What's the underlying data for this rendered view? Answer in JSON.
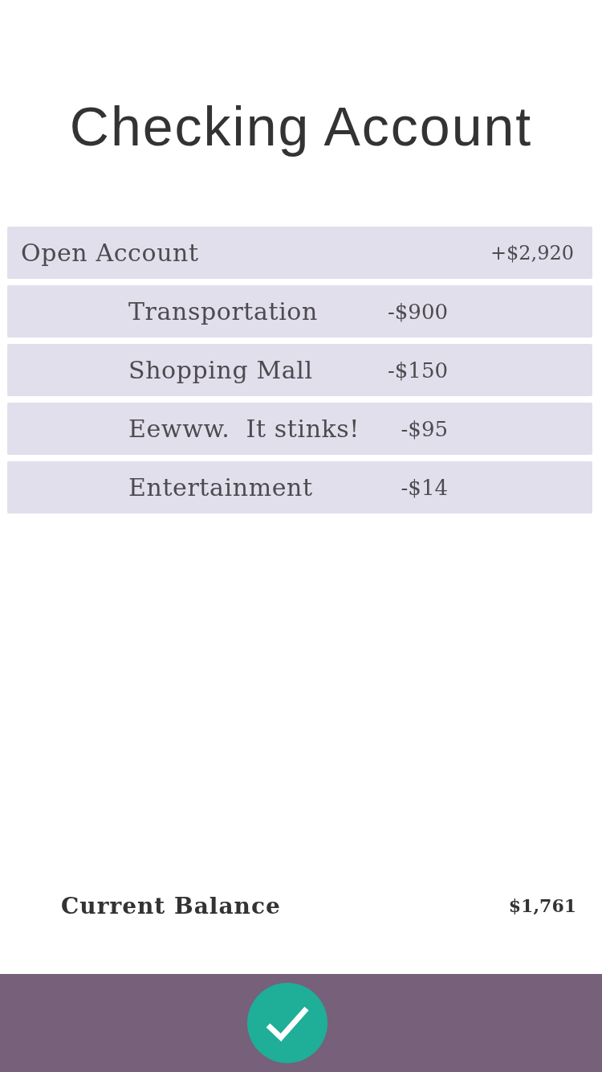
{
  "header": {
    "title": "Checking Account"
  },
  "transactions": [
    {
      "kind": "opening",
      "label": "Open Account",
      "amount": "+$2,920"
    },
    {
      "kind": "expense",
      "label": "Transportation",
      "amount": "-$900"
    },
    {
      "kind": "expense",
      "label": "Shopping Mall",
      "amount": "-$150"
    },
    {
      "kind": "expense",
      "label": "Eewww.  It stinks!",
      "amount": "-$95"
    },
    {
      "kind": "expense",
      "label": "Entertainment",
      "amount": "-$14"
    }
  ],
  "balance": {
    "label": "Current Balance",
    "amount": "$1,761"
  },
  "footer": {
    "confirm_button": {
      "kind": "check"
    }
  }
}
